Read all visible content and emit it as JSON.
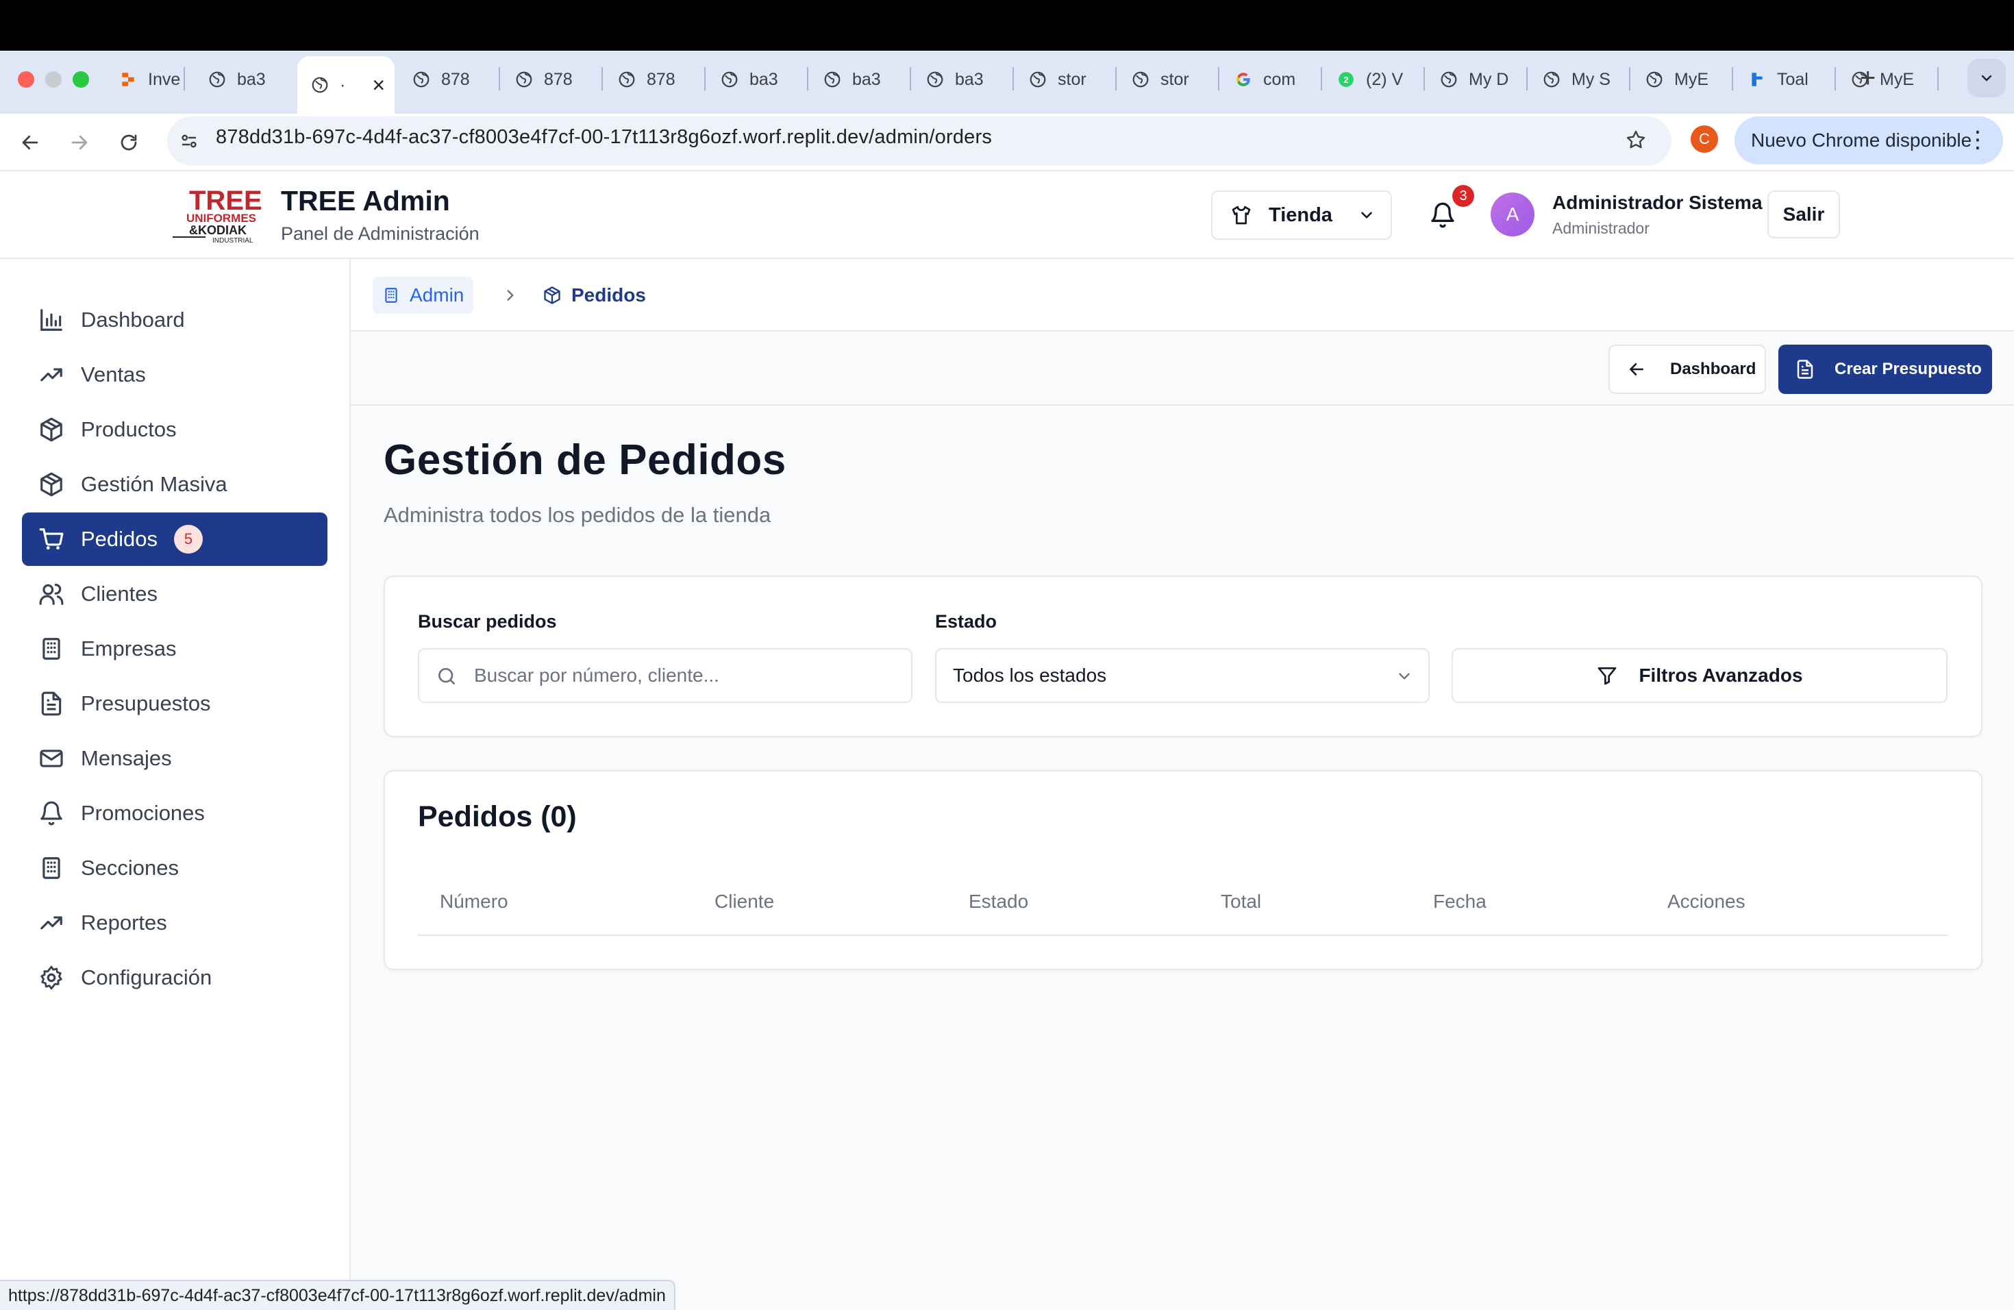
{
  "browser": {
    "tabs": [
      {
        "label": "Inve",
        "icon": "replit-icon"
      },
      {
        "label": "ba3",
        "icon": "globe-icon"
      },
      {
        "label": "·",
        "icon": "globe-icon",
        "active": true
      },
      {
        "label": "878",
        "icon": "globe-icon"
      },
      {
        "label": "878",
        "icon": "globe-icon"
      },
      {
        "label": "878",
        "icon": "globe-icon"
      },
      {
        "label": "ba3",
        "icon": "globe-icon"
      },
      {
        "label": "ba3",
        "icon": "globe-icon"
      },
      {
        "label": "ba3",
        "icon": "globe-icon"
      },
      {
        "label": "stor",
        "icon": "globe-icon"
      },
      {
        "label": "stor",
        "icon": "globe-icon"
      },
      {
        "label": "com",
        "icon": "google-icon"
      },
      {
        "label": "(2) V",
        "icon": "whatsapp-icon"
      },
      {
        "label": "My D",
        "icon": "globe-icon"
      },
      {
        "label": "My S",
        "icon": "globe-icon"
      },
      {
        "label": "MyE",
        "icon": "globe-icon"
      },
      {
        "label": "Toal",
        "icon": "flag-icon"
      },
      {
        "label": "MyE",
        "icon": "globe-icon"
      }
    ],
    "new_tab": "+",
    "url": "878dd31b-697c-4d4f-ac37-cf8003e4f7cf-00-17t113r8g6ozf.worf.replit.dev/admin/orders",
    "profile_initial": "C",
    "update_label": "Nuevo Chrome disponible",
    "status_url": "https://878dd31b-697c-4d4f-ac37-cf8003e4f7cf-00-17t113r8g6ozf.worf.replit.dev/admin"
  },
  "header": {
    "logo_line1": "TREE",
    "logo_line2": "UNIFORMES",
    "logo_line3": "&KODIAK",
    "logo_line4": "INDUSTRIAL",
    "title": "TREE Admin",
    "subtitle": "Panel de Administración",
    "store_label": "Tienda",
    "notifications_count": "3",
    "avatar_initial": "A",
    "user_name": "Administrador Sistema",
    "user_role": "Administrador",
    "logout_label": "Salir"
  },
  "sidebar": {
    "items": [
      {
        "label": "Dashboard",
        "icon": "bar-chart-icon"
      },
      {
        "label": "Ventas",
        "icon": "trending-up-icon"
      },
      {
        "label": "Productos",
        "icon": "package-icon"
      },
      {
        "label": "Gestión Masiva",
        "icon": "package-icon"
      },
      {
        "label": "Pedidos",
        "icon": "shopping-cart-icon",
        "badge": "5",
        "active": true
      },
      {
        "label": "Clientes",
        "icon": "users-icon"
      },
      {
        "label": "Empresas",
        "icon": "building-icon"
      },
      {
        "label": "Presupuestos",
        "icon": "file-text-icon"
      },
      {
        "label": "Mensajes",
        "icon": "mail-icon"
      },
      {
        "label": "Promociones",
        "icon": "bell-icon"
      },
      {
        "label": "Secciones",
        "icon": "building-icon"
      },
      {
        "label": "Reportes",
        "icon": "trending-up-icon"
      },
      {
        "label": "Configuración",
        "icon": "gear-icon"
      }
    ]
  },
  "breadcrumb": {
    "root": "Admin",
    "current": "Pedidos"
  },
  "actions": {
    "dashboard_label": "Dashboard",
    "create_label": "Crear Presupuesto"
  },
  "page": {
    "title": "Gestión de Pedidos",
    "subtitle": "Administra todos los pedidos de la tienda"
  },
  "filters": {
    "search_label": "Buscar pedidos",
    "search_placeholder": "Buscar por número, cliente...",
    "search_value": "",
    "status_label": "Estado",
    "status_value": "Todos los estados",
    "advanced_label": "Filtros Avanzados"
  },
  "orders": {
    "title": "Pedidos (0)",
    "columns": [
      "Número",
      "Cliente",
      "Estado",
      "Total",
      "Fecha",
      "Acciones"
    ],
    "rows": []
  },
  "colors": {
    "primary": "#1e3a8a",
    "badge_red": "#dc2626",
    "link_blue": "#2563eb"
  }
}
